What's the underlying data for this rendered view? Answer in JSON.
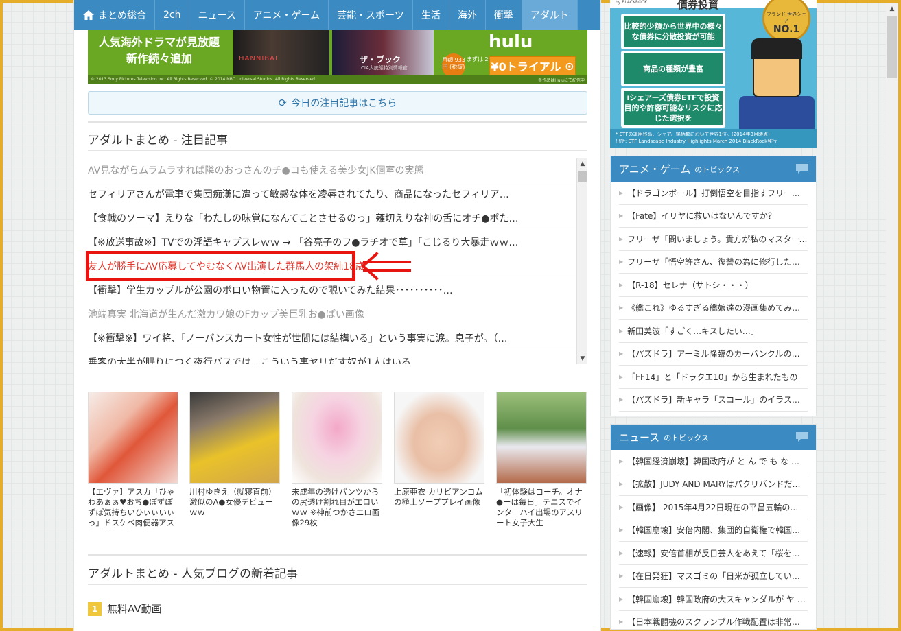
{
  "nav": {
    "items": [
      "まとめ総合",
      "2ch",
      "ニュース",
      "アニメ・ゲーム",
      "芸能・スポーツ",
      "生活",
      "海外",
      "衝撃",
      "アダルト"
    ],
    "active": "アダルト"
  },
  "banner": {
    "text_line1": "人気海外ドラマが見放題",
    "text_line2": "新作続々追加",
    "poster1_title": "HANNIBAL",
    "poster2_title": "ザ・ブック",
    "poster2_sub": "CIA大統領特別情報官",
    "logo": "hulu",
    "price": "月額 933円 (税抜)",
    "trial_period": "まずは 2週間",
    "trial_label": "¥0トライアル",
    "footer_left": "© 2013 Sony Pictures Television Inc. All Rights Reserved. © 2014 NBC Universal Studios. All Rights Reserved.",
    "footer_right": "各作品はHuluにて配信中"
  },
  "refresh": {
    "label": "今日の注目記事はこちら"
  },
  "section1": {
    "title": "アダルトまとめ - 注目記事"
  },
  "articles": [
    {
      "text": "AV見ながらムラムラすれば隣のおっさんのチ●コも使える美少女JK個室の実態",
      "style": "gray"
    },
    {
      "text": "セフィリアさんが電車で集団痴漢に遭って敏感な体を凌辱されてたり、商品になったセフィリア…",
      "style": "normal"
    },
    {
      "text": "【食戟のソーマ】えりな「わたしの味覚になんてことさせるのっ」薙切えりな神の舌にオチ●ポた…",
      "style": "normal"
    },
    {
      "text": "【※放送事故※】TVでの淫語キャプスレｗｗ → 「谷亮子のフ●ラチオで草」「こじるり大暴走ｗｗ…",
      "style": "normal"
    },
    {
      "text": "友人が勝手にAV応募してやむなくAV出演した群馬人の架純18歳",
      "style": "red"
    },
    {
      "text": "【衝撃】学生カップルが公園のボロい物置に入ったので覗いてみた結果･･････････…",
      "style": "normal"
    },
    {
      "text": "池端真実 北海道が生んだ激カワ娘のFカップ美巨乳お●ぱい画像",
      "style": "gray"
    },
    {
      "text": "【※衝撃※】ワイ将、「ノーパンスカート女性が世間には結構いる」という事実に涙。息子が。（…",
      "style": "normal"
    },
    {
      "text": "乗客の大半が眠りにつく夜行バスでは、こういう事ヤリだす奴が1人はいる…",
      "style": "normal"
    }
  ],
  "thumbs": [
    {
      "caption": "【エヴァ】アスカ「ひゃわあぁぁ♥おち●ぽずぽずぽ気持ちいひぃぃいぃっ」ドスケベ肉便器アスカが輪姦されておち●"
    },
    {
      "caption": "川村ゆきえ（就寝直前）激似のA●女優デビューｗｗ"
    },
    {
      "caption": "未成年の透けパンツからの尻透け割れ目がエロいｗｗ ※神前つかさエロ画像29枚"
    },
    {
      "caption": "上原亜衣 カリビアンコムの極上ソーププレイ画像"
    },
    {
      "caption": "「初体験はコーチ。オナ●ーは毎日」テニスでインターハイ出場のアスリート女子大生"
    }
  ],
  "section2": {
    "title": "アダルトまとめ - 人気ブログの新着記事"
  },
  "blog_rank": {
    "rank": "1",
    "name": "無料AV動画"
  },
  "side_ad": {
    "brand": "by BLACKROCK",
    "headline": "債券投資",
    "card1": "比較的少額から世界中の様々な債券に分散投資が可能",
    "card2": "商品の種類が豊富",
    "card3": "iシェアーズ債券ETFで投資目的や許容可能なリスクに応じた選択を",
    "medal_text": "ブランド 世界シェア",
    "medal_no": "NO.1",
    "footer_line1": "* ETFの運用残高、シェア、銘柄数において世界1位。(2014年3月時点)",
    "footer_line2": "出所: ETF Landscape Industry Highlights March 2014 BlackRock発行"
  },
  "anime": {
    "title": "アニメ・ゲーム",
    "suffix": "のトピックス",
    "items": [
      "【ドラゴンボール】打倒悟空を目指すフリーザ様の…",
      "【Fate】イリヤに救いはないんですか？",
      "フリーザ「問いましょう。貴方が私のマスターですか…",
      "フリーザ「悟空許さん、復讐の為に修行したぞ！」…",
      "【R-18】セレナ（サトシ・・・）",
      "《艦これ》ゆるすぎる艦娘達の漫画集めてみたｗ…",
      "新田美波「すごく…キスしたい…」",
      "【パズドラ】アーミル降臨のカーバンクルのセリフが痛…",
      "「FF14」と「ドラクエ10」から生まれたもの",
      "【パズドラ】新キャラ「スコール」のイラストに批判殺…"
    ]
  },
  "news": {
    "title": "ニュース",
    "suffix": "のトピックス",
    "items": [
      "【韓国経済崩壊】韓国政府が と ん で も な い …",
      "【拡散】JUDY AND MARYはパクリバンドだった…",
      "【画像】 2015年4月22日現在の平昌五輪の…",
      "【韓国崩壊】安倍内閣、集団的自衛権で韓国…",
      "【速報】安倍首相が反日芸人をあえて「桜を見る…",
      "【在日発狂】マスゴミの「日米が孤立している」とい…",
      "【韓国崩壊】韓国政府の大スキャンダルが ヤ バ …",
      "【日本戦闘機のスクランブル作戦配置は非常に…"
    ]
  }
}
